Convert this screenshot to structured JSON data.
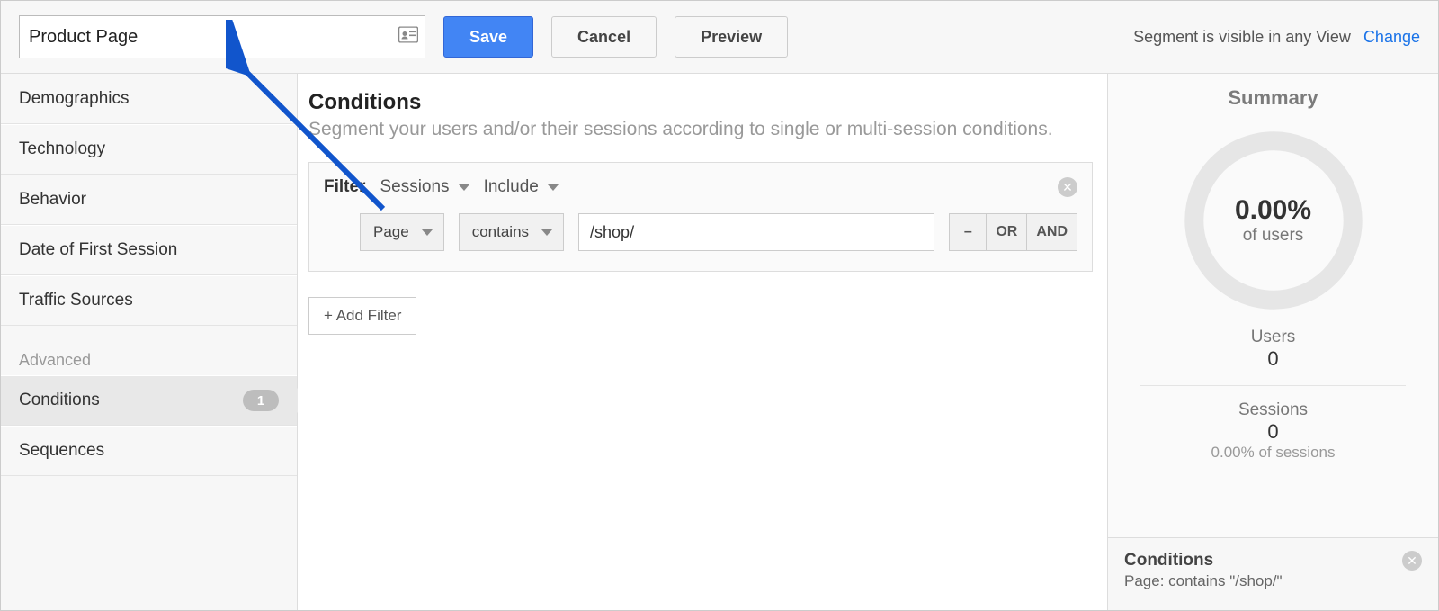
{
  "toolbar": {
    "name_value": "Product Page",
    "save_label": "Save",
    "cancel_label": "Cancel",
    "preview_label": "Preview",
    "visibility_text": "Segment is visible in any View",
    "change_label": "Change"
  },
  "sidebar": {
    "items": [
      "Demographics",
      "Technology",
      "Behavior",
      "Date of First Session",
      "Traffic Sources"
    ],
    "advanced_label": "Advanced",
    "advanced_items": [
      {
        "label": "Conditions",
        "badge": "1",
        "active": true
      },
      {
        "label": "Sequences",
        "badge": null,
        "active": false
      }
    ]
  },
  "main": {
    "title": "Conditions",
    "subtitle": "Segment your users and/or their sessions according to single or multi-session conditions.",
    "filter_label": "Filter",
    "scope_label": "Sessions",
    "include_label": "Include",
    "dimension_label": "Page",
    "match_label": "contains",
    "value": "/shop/",
    "op_minus": "–",
    "op_or": "OR",
    "op_and": "AND",
    "add_filter_label": "+ Add Filter"
  },
  "summary": {
    "title": "Summary",
    "donut_value": "0.00%",
    "donut_label": "of users",
    "users_label": "Users",
    "users_value": "0",
    "sessions_label": "Sessions",
    "sessions_value": "0",
    "sessions_sub": "0.00% of sessions",
    "cond_title": "Conditions",
    "cond_line": "Page: contains \"/shop/\""
  }
}
